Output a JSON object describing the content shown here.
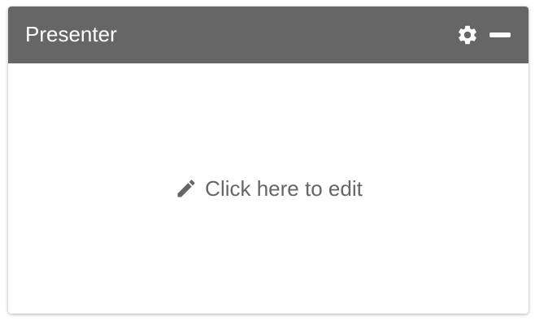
{
  "panel": {
    "title": "Presenter",
    "header_color": "#666666",
    "icons": {
      "settings": "gear-icon",
      "minimize": "minus-icon",
      "edit": "pencil-icon"
    }
  },
  "body": {
    "edit_label": "Click here to edit",
    "text_color": "#666666"
  }
}
